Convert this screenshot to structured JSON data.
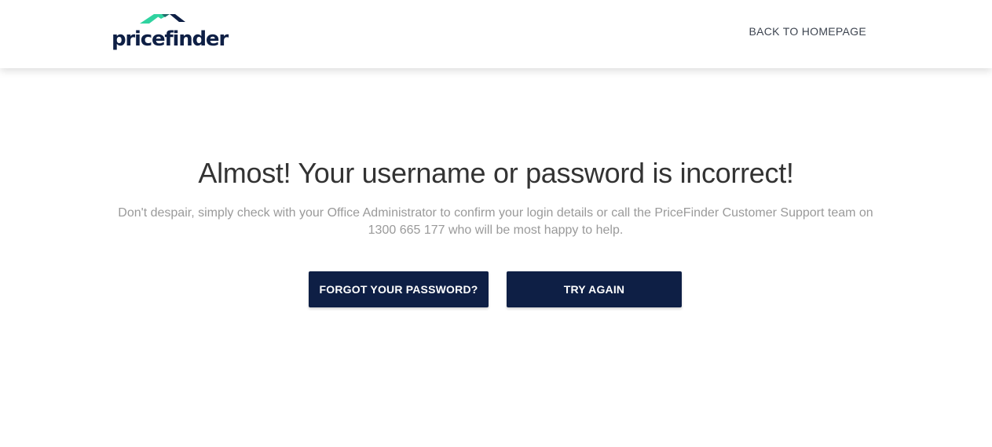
{
  "header": {
    "logo_text": "pricefinder",
    "back_link": "BACK TO HOMEPAGE"
  },
  "main": {
    "title": "Almost! Your username or password is incorrect!",
    "message": "Don't despair, simply check with your Office Administrator to confirm your login details or call the PriceFinder Customer Support team on 1300 665 177 who will be most happy to help.",
    "forgot_button": "FORGOT YOUR PASSWORD?",
    "retry_button": "TRY AGAIN"
  },
  "colors": {
    "navy": "#0e1f45",
    "logo_green": "#2fd3a0",
    "logo_dark": "#0e1f45",
    "text_dark": "#333333",
    "text_muted": "#9a9a9a"
  },
  "icons": {
    "logo_mark": "roof-chevron-icon"
  }
}
